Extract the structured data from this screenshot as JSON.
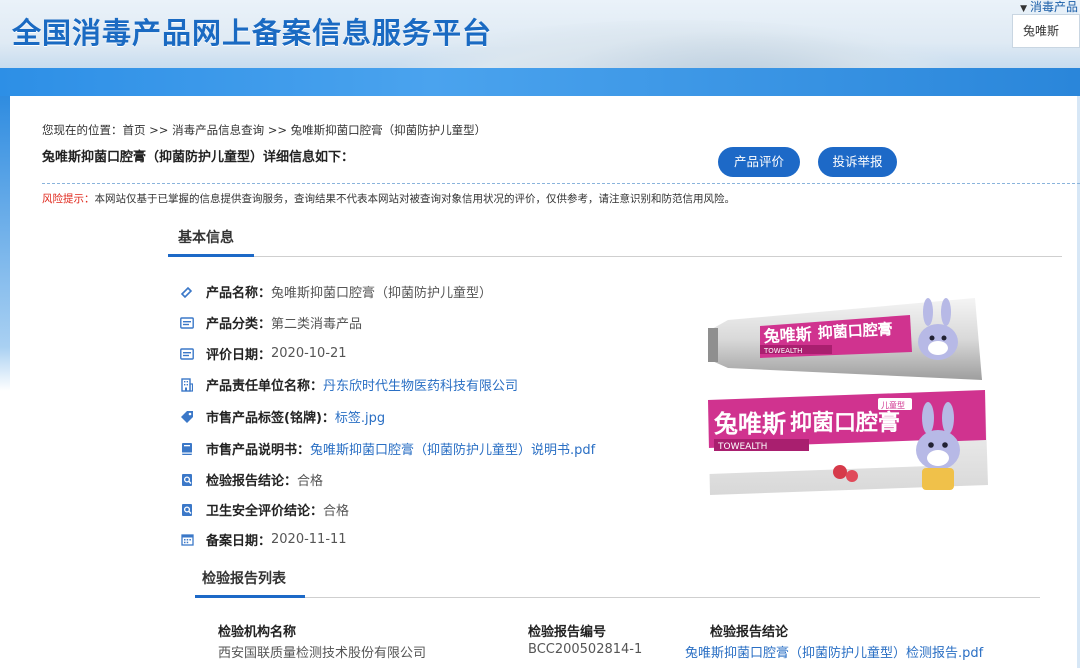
{
  "header": {
    "site_title": "全国消毒产品网上备案信息服务平台",
    "search_tab": "消毒产品",
    "search_value": "兔唯斯"
  },
  "breadcrumb": {
    "text": "您现在的位置：首页 >> 消毒产品信息查询 >> 兔唯斯抑菌口腔膏（抑菌防护儿童型）"
  },
  "page_heading": "兔唯斯抑菌口腔膏（抑菌防护儿童型）详细信息如下：",
  "buttons": {
    "evaluate": "产品评价",
    "report": "投诉举报"
  },
  "risk": {
    "label": "风险提示：",
    "text": "本网站仅基于已掌握的信息提供查询服务，查询结果不代表本网站对被查询对象信用状况的评价，仅供参考，请注意识别和防范信用风险。"
  },
  "basic": {
    "title": "基本信息",
    "rows": [
      {
        "label": "产品名称：",
        "value": "兔唯斯抑菌口腔膏（抑菌防护儿童型）",
        "icon": "tag-outline-icon"
      },
      {
        "label": "产品分类：",
        "value": "第二类消毒产品",
        "icon": "id-card-icon"
      },
      {
        "label": "评价日期：",
        "value": "2020-10-21",
        "icon": "id-card-icon"
      },
      {
        "label": "产品责任单位名称：",
        "value": "丹东欣时代生物医药科技有限公司",
        "icon": "building-icon"
      },
      {
        "label": "市售产品标签(铭牌)：",
        "value": "标签.jpg",
        "icon": "label-icon"
      },
      {
        "label": "市售产品说明书：",
        "value": "兔唯斯抑菌口腔膏（抑菌防护儿童型）说明书.pdf",
        "icon": "book-icon"
      },
      {
        "label": "检验报告结论：",
        "value": "合格",
        "icon": "inspect-icon"
      },
      {
        "label": "卫生安全评价结论：",
        "value": "合格",
        "icon": "inspect-icon"
      },
      {
        "label": "备案日期：",
        "value": "2020-11-11",
        "icon": "calendar-icon"
      }
    ]
  },
  "product_image": {
    "tube_brand": "兔唯斯",
    "tube_product": "抑菌口腔膏",
    "tube_en": "TOWEALTH",
    "box_brand": "兔唯斯",
    "box_product": "抑菌口腔膏",
    "box_en": "TOWEALTH",
    "box_badge": "儿童型"
  },
  "reports": {
    "title": "检验报告列表",
    "columns": [
      "检验机构名称",
      "检验报告编号",
      "检验报告结论"
    ],
    "rows": [
      [
        "西安国联质量检测技术股份有限公司",
        "BCC200502814-1",
        "兔唯斯抑菌口腔膏（抑菌防护儿童型）检测报告.pdf"
      ]
    ]
  },
  "colors": {
    "brand_blue": "#1d69c7",
    "link_blue": "#2a6fc4",
    "risk_red": "#e0281c",
    "product_pink": "#d0338f"
  }
}
